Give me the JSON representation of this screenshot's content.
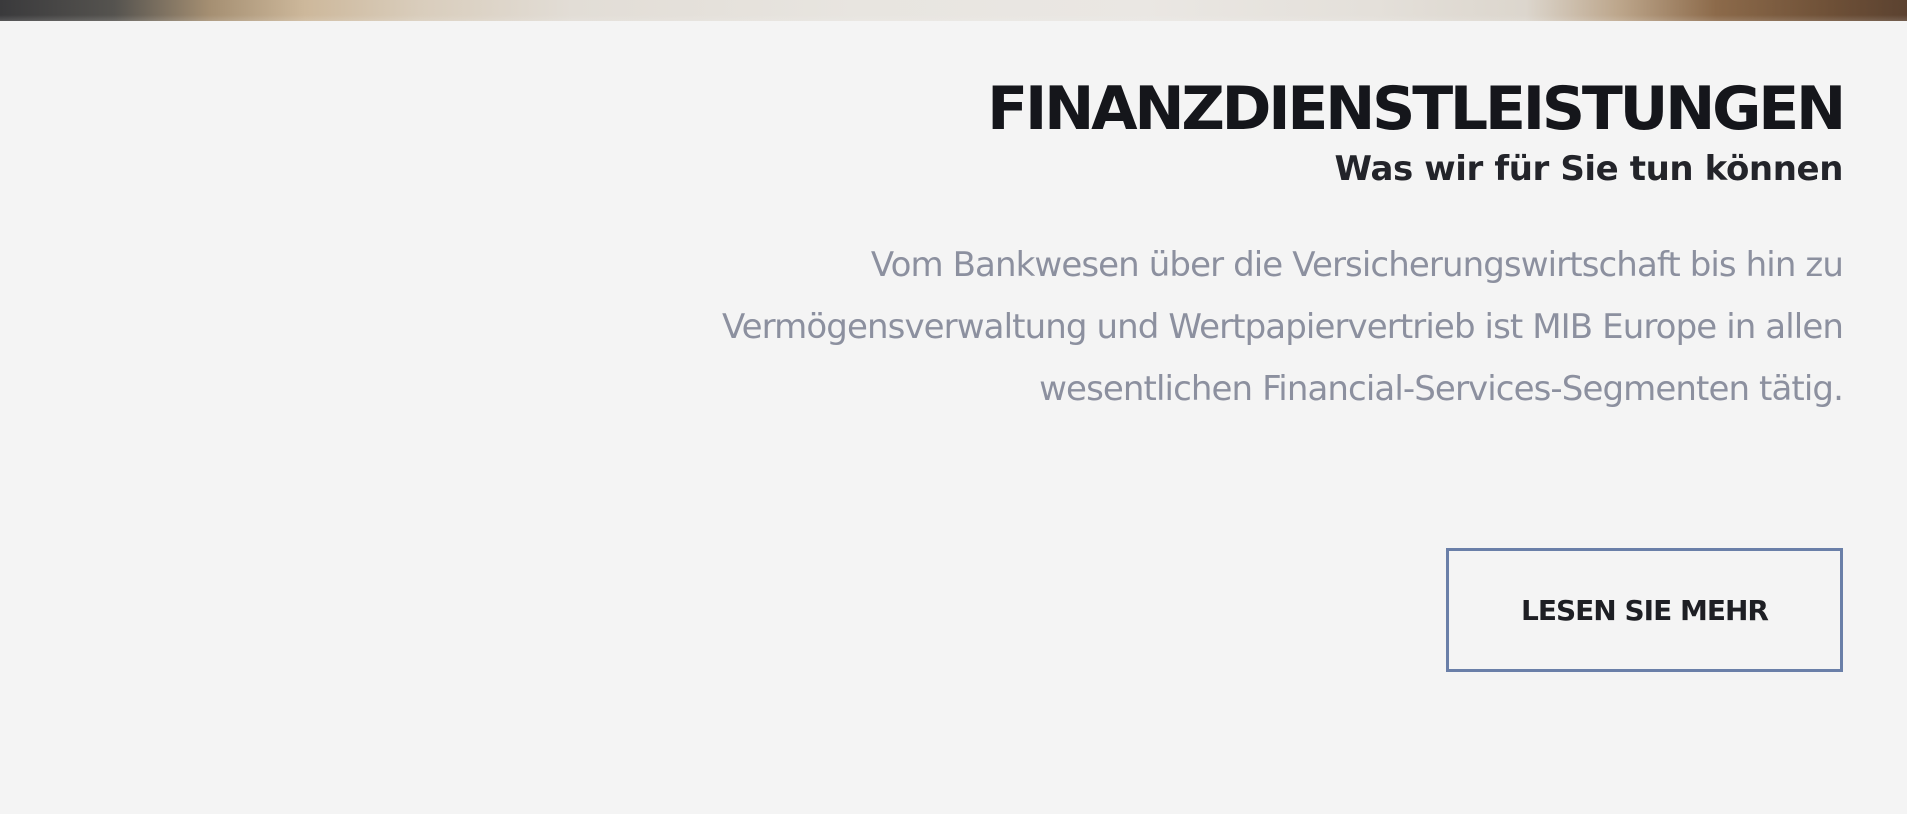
{
  "section": {
    "title": "FINANZDIENSTLEISTUNGEN",
    "subtitle": "Was wir für Sie tun können",
    "description": "Vom Bankwesen über die Versicherungswirtschaft bis hin zu Vermögensverwaltung und Wertpapiervertrieb ist MIB Europe in allen wesentlichen Financial-Services-Segmenten tätig.",
    "button_label": "LESEN SIE MEHR"
  },
  "colors": {
    "background": "#f4f4f4",
    "title": "#15161b",
    "body_text": "#8c909f",
    "button_border": "#6a7fa8"
  }
}
